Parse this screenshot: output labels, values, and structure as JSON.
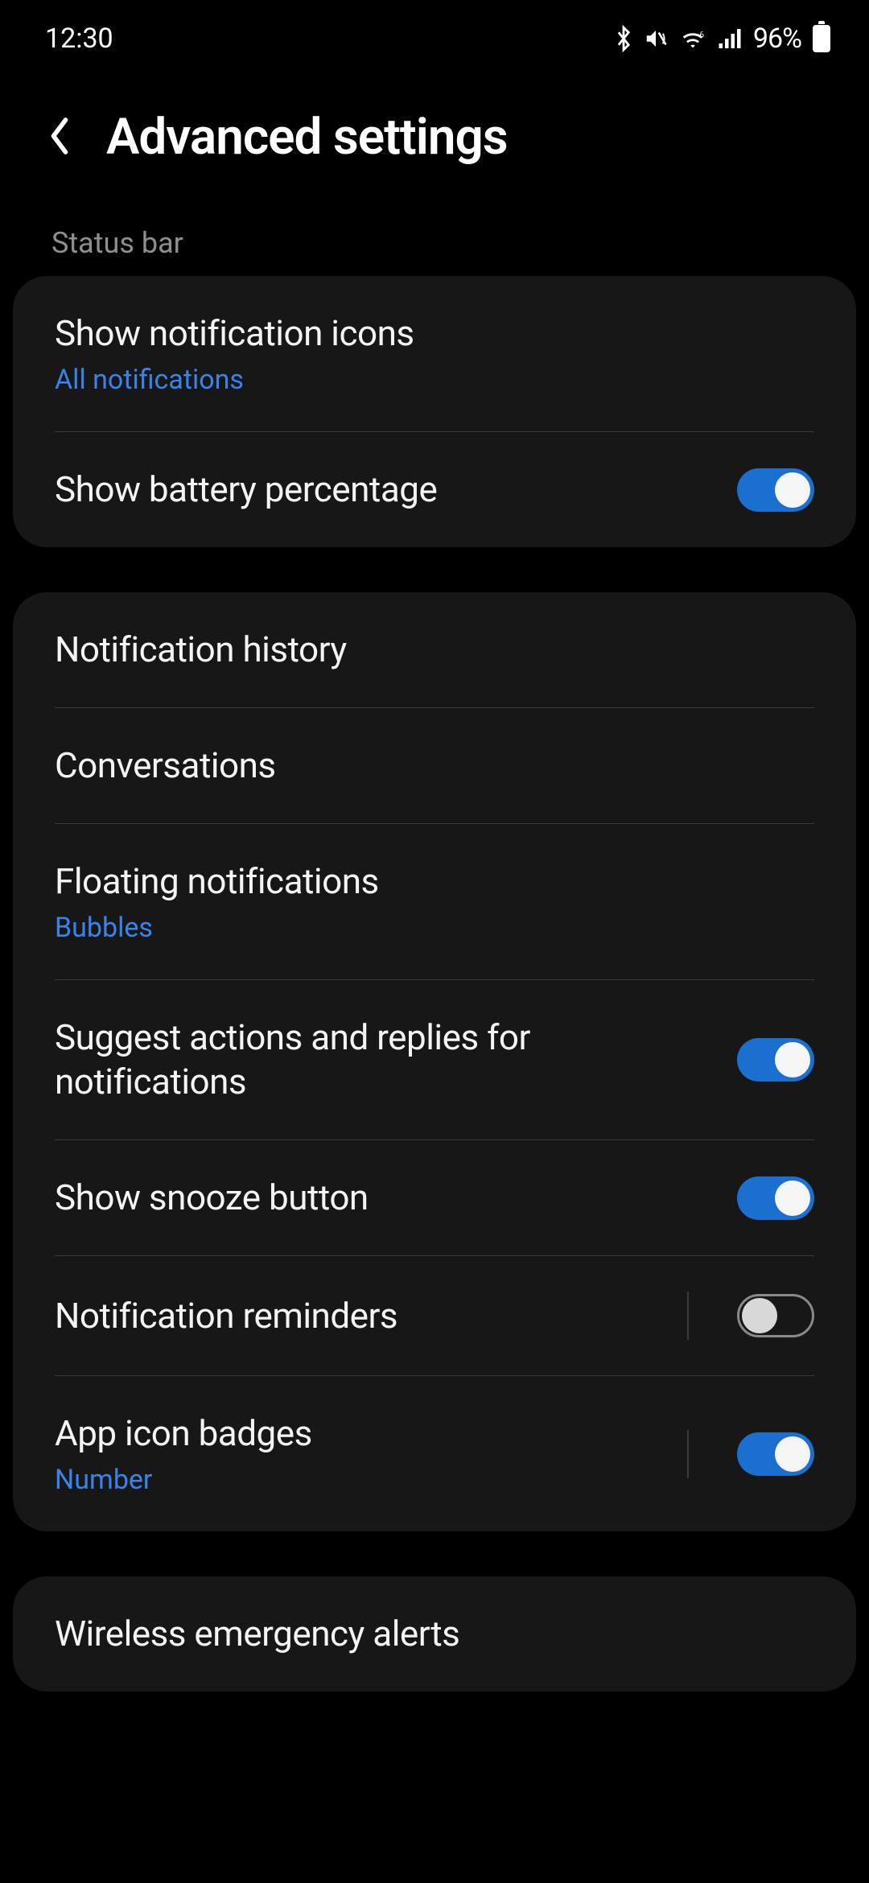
{
  "status": {
    "time": "12:30",
    "battery_percent": "96%"
  },
  "header": {
    "title": "Advanced settings"
  },
  "section1": {
    "label": "Status bar",
    "items": [
      {
        "title": "Show notification icons",
        "sub": "All notifications"
      },
      {
        "title": "Show battery percentage"
      }
    ]
  },
  "section2": {
    "items": [
      {
        "title": "Notification history"
      },
      {
        "title": "Conversations"
      },
      {
        "title": "Floating notifications",
        "sub": "Bubbles"
      },
      {
        "title": "Suggest actions and replies for notifications"
      },
      {
        "title": "Show snooze button"
      },
      {
        "title": "Notification reminders"
      },
      {
        "title": "App icon badges",
        "sub": "Number"
      }
    ]
  },
  "section3": {
    "items": [
      {
        "title": "Wireless emergency alerts"
      }
    ]
  }
}
